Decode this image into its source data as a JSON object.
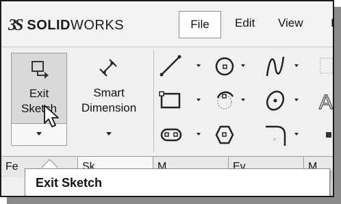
{
  "app": {
    "logo_solid": "SOLID",
    "logo_works": "WORKS",
    "logo_mark": "3S"
  },
  "menu": {
    "file": "File",
    "edit": "Edit",
    "view": "View",
    "more": "I"
  },
  "ribbon": {
    "exit_sketch": {
      "line1": "Exit",
      "line2": "Sketch"
    },
    "smart_dimension": {
      "line1": "Smart",
      "line2": "Dimension"
    },
    "tools": [
      "line-icon",
      "circle-icon",
      "spline-icon",
      "rectangle-icon",
      "arc-icon",
      "ellipse-icon",
      "slot-icon",
      "polygon-icon",
      "fillet-icon",
      "text-icon"
    ]
  },
  "tabs": [
    {
      "label": "Fe"
    },
    {
      "label": "Sk"
    },
    {
      "label": "M"
    },
    {
      "label": "Ev"
    },
    {
      "label": "M"
    }
  ],
  "tooltip": {
    "text": "Exit Sketch"
  },
  "colors": {
    "frame": "#1a1a1a",
    "ribbon_bg": "#f0f0f0",
    "button_pressed": "#d9d9d9",
    "tooltip_bg": "#ffffff"
  }
}
